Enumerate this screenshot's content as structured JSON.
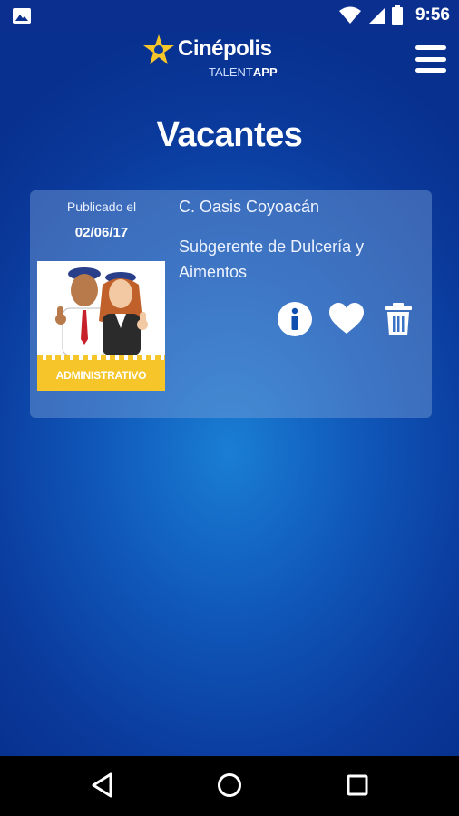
{
  "status_bar": {
    "time": "9:56",
    "icons": [
      "image-icon",
      "wifi-icon",
      "signal-icon",
      "battery-icon"
    ]
  },
  "header": {
    "brand": "Cinépolis",
    "sub_regular": "TALENT",
    "sub_bold": "APP",
    "menu_icon": "hamburger-menu-icon"
  },
  "page": {
    "title": "Vacantes"
  },
  "vacancies": [
    {
      "published_label": "Publicado el",
      "published_date": "02/06/17",
      "category": "ADMINISTRATIVO",
      "location": "C. Oasis Coyoacán",
      "position": "Subgerente de Dulcería y Aimentos",
      "actions": [
        "info-icon",
        "heart-icon",
        "trash-icon"
      ]
    }
  ],
  "nav_bar": {
    "icons": [
      "back-icon",
      "home-icon",
      "recent-apps-icon"
    ]
  },
  "colors": {
    "background_center": "#1a7ed4",
    "background_edge": "#08308e",
    "brand_yellow": "#f6c52a",
    "card_overlay": "rgba(120,160,215,0.45)",
    "text": "#ffffff"
  }
}
